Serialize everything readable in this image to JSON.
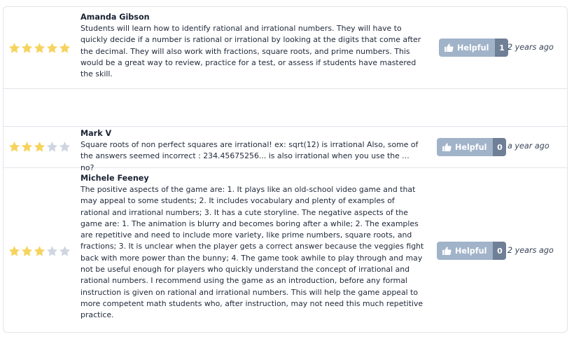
{
  "colors": {
    "star_filled": "#f6d35d",
    "star_empty": "#cfd6e2",
    "helpful_bg": "#a1b3c9",
    "count_bg": "#6f7f96"
  },
  "icons": {
    "star": "star-icon",
    "thumb": "thumbs-up-icon"
  },
  "reviews": [
    {
      "author": "Amanda Gibson",
      "rating": 5,
      "text": "Students will learn how to identify rational and irrational numbers. They will have to quickly decide if a number is rational or irrational by looking at the digits that come after the decimal. They will also work with fractions, square roots, and prime numbers. This would be a great way to review, practice for a test, or assess if students have mastered the skill.",
      "helpful_label": "Helpful",
      "helpful_count": "1",
      "time": "2 years ago"
    },
    {
      "author": "Mark V",
      "rating": 3,
      "text": "Square roots of non perfect squares are irrational! ex: sqrt(12) is irrational Also, some of the answers seemed incorrect : 234.45675256... is also irrational when you use the ... no?",
      "helpful_label": "Helpful",
      "helpful_count": "0",
      "time": "a year ago"
    },
    {
      "author": "Michele Feeney",
      "rating": 3,
      "text": "The positive aspects of the game are: 1. It plays like an old-school video game and that may appeal to some students; 2. It includes vocabulary and plenty of examples of rational and irrational numbers; 3. It has a cute storyline. The negative aspects of the game are: 1. The animation is blurry and becomes boring after a while; 2. The examples are repetitive and need to include more variety, like prime numbers, square roots, and fractions; 3. It is unclear when the player gets a correct answer because the veggies fight back with more power than the bunny; 4. The game took awhile to play through and may not be useful enough for players who quickly understand the concept of irrational and rational numbers. I recommend using the game as an introduction, before any formal instruction is given on rational and irrational numbers. This will help the game appeal to more competent math students who, after instruction, may not need this much repetitive practice.",
      "helpful_label": "Helpful",
      "helpful_count": "0",
      "time": "2 years ago"
    }
  ]
}
